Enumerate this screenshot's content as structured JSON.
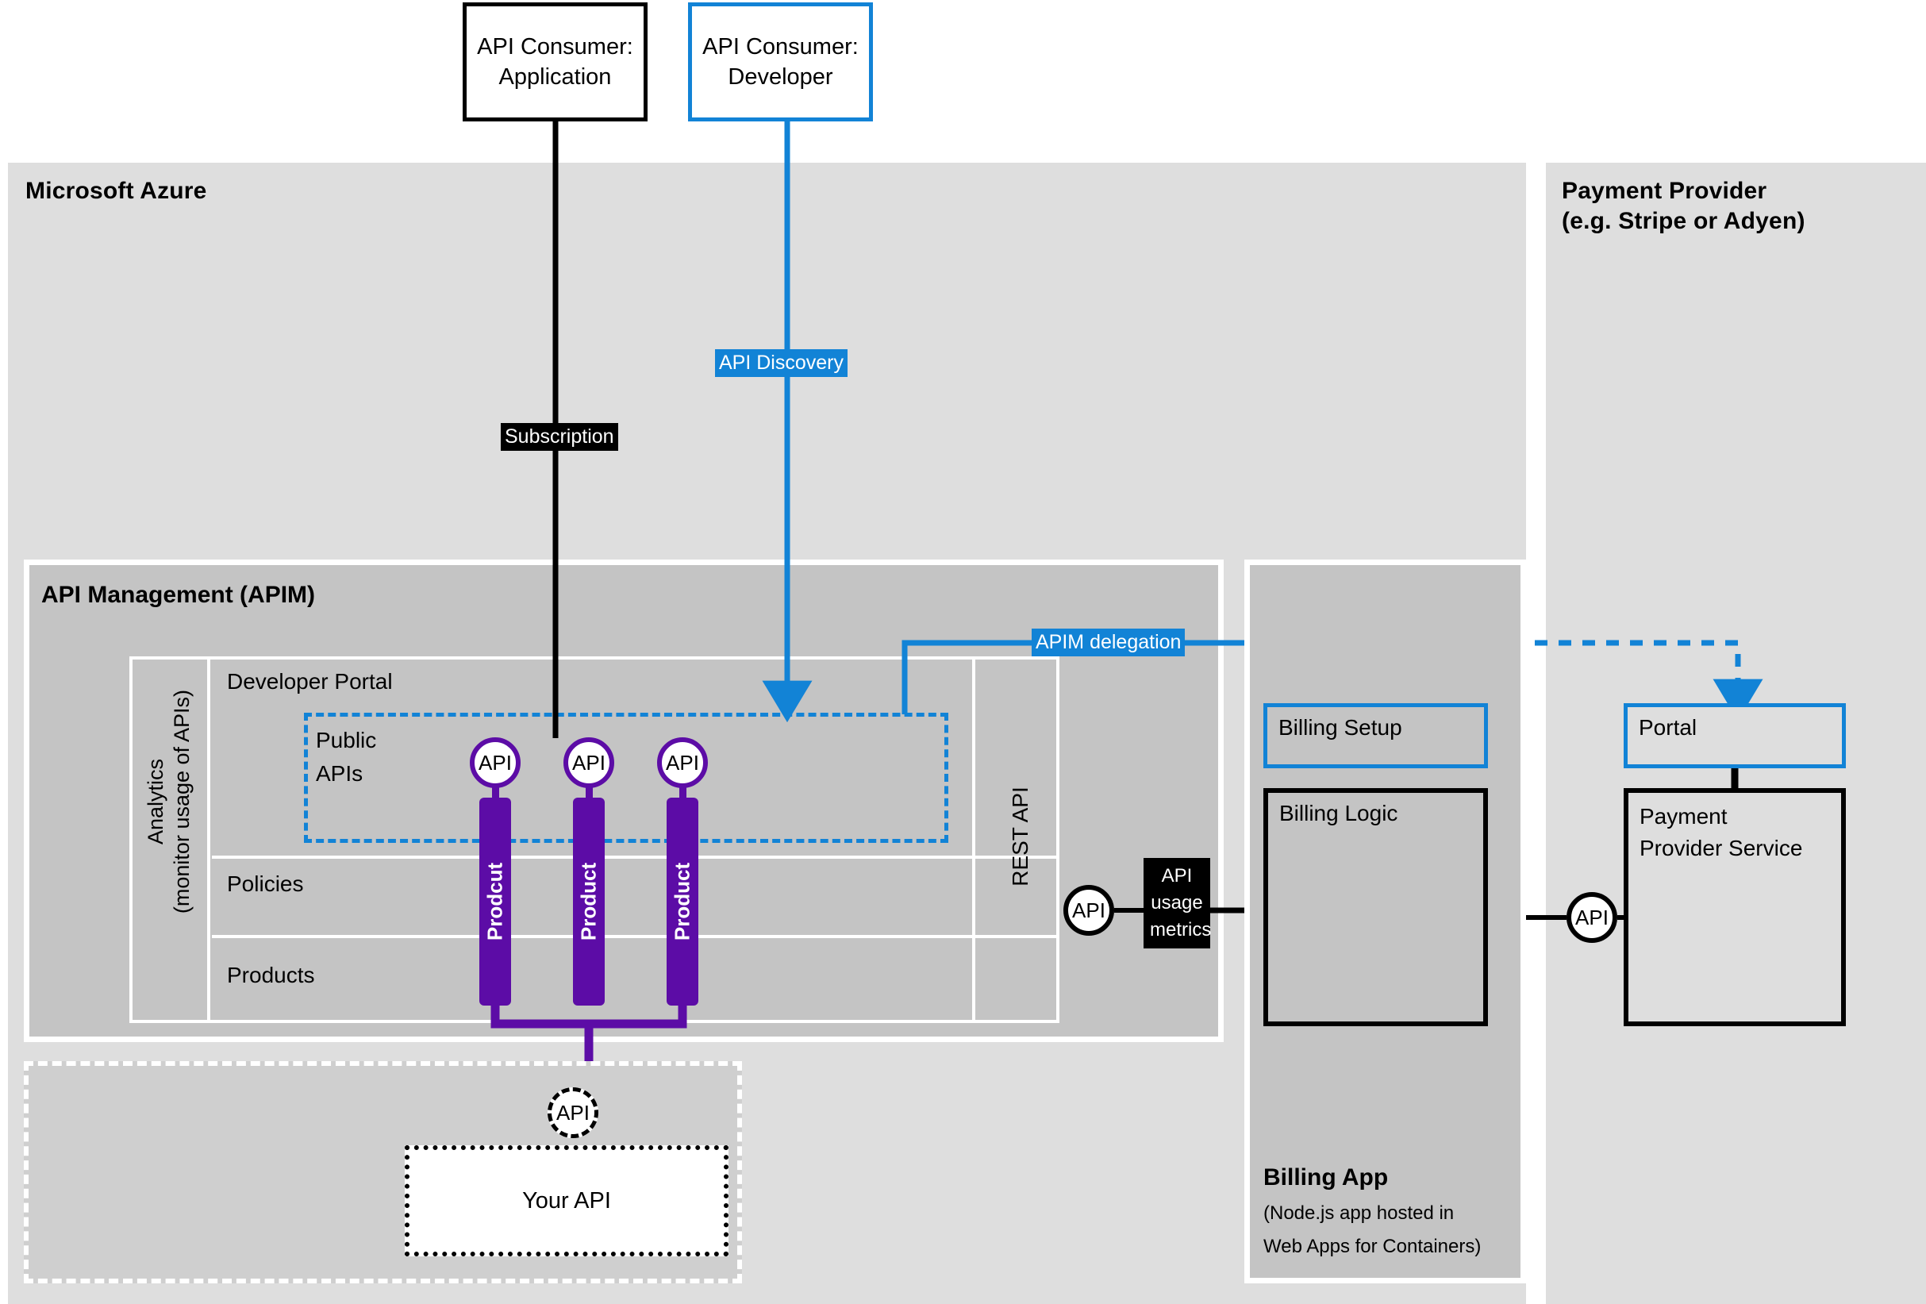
{
  "diagram": {
    "title": "Azure API Management monetization architecture",
    "colors": {
      "azure_blue": "#1283d6",
      "product_purple": "#5c0ca6",
      "panel_gray": "#dedede",
      "inner_gray": "#c4c4c4",
      "black": "#000000",
      "white": "#ffffff"
    }
  },
  "consumers": [
    {
      "id": "application",
      "label": "API Consumer:\nApplication",
      "line1": "API Consumer:",
      "line2": "Application",
      "border": "#000000"
    },
    {
      "id": "developer",
      "label": "API Consumer:\nDeveloper",
      "line1": "API Consumer:",
      "line2": "Developer",
      "border": "#1283d6"
    }
  ],
  "panels": {
    "azure": {
      "title": "Microsoft Azure"
    },
    "payment_provider": {
      "title_line1": "Payment Provider",
      "title_line2": "(e.g. Stripe or Adyen)"
    }
  },
  "apim": {
    "title": "API Management (APIM)",
    "analytics_line1": "Analytics",
    "analytics_line2": "(monitor usage of APIs)",
    "rows": [
      {
        "id": "developer-portal",
        "label": "Developer Portal"
      },
      {
        "id": "policies",
        "label": "Policies"
      },
      {
        "id": "products",
        "label": "Products"
      }
    ],
    "rest_api_label": "REST API",
    "public_apis": {
      "line1": "Public",
      "line2": "APIs"
    },
    "api_nodes": [
      {
        "id": "api-1",
        "label": "API",
        "product": "Prodcut"
      },
      {
        "id": "api-2",
        "label": "API",
        "product": "Product"
      },
      {
        "id": "api-3",
        "label": "API",
        "product": "Product"
      }
    ],
    "rest_api_node_label": "API"
  },
  "your_api": {
    "node_label": "API",
    "box_label": "Your API"
  },
  "billing_app": {
    "title": "Billing App",
    "subtitle_line1": "(Node.js app hosted in",
    "subtitle_line2": "Web Apps for Containers)",
    "setup_label": "Billing Setup",
    "logic_label": "Billing Logic"
  },
  "payment_provider": {
    "portal_label": "Portal",
    "service_line1": "Payment",
    "service_line2": "Provider Service",
    "api_node_label": "API"
  },
  "connector_labels": {
    "subscription": "Subscription",
    "api_discovery": "API Discovery",
    "apim_delegation": "APIM delegation",
    "api_usage_metrics_line1": "API",
    "api_usage_metrics_line2": "usage",
    "api_usage_metrics_line3": "metrics"
  }
}
